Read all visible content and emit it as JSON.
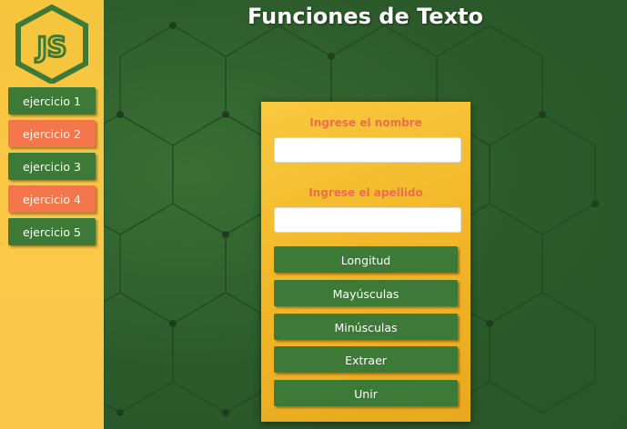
{
  "page": {
    "title": "Funciones de Texto"
  },
  "sidebar": {
    "logo_text": "JS",
    "items": [
      {
        "label": "ejercicio 1",
        "color": "#3e7a37"
      },
      {
        "label": "ejercicio 2",
        "color": "#f3774b"
      },
      {
        "label": "ejercicio 3",
        "color": "#3e7a37"
      },
      {
        "label": "ejercicio 4",
        "color": "#f3774b"
      },
      {
        "label": "ejercicio 5",
        "color": "#3e7a37"
      }
    ]
  },
  "form": {
    "nombre_label": "Ingrese el nombre",
    "nombre_value": "",
    "apellido_label": "Ingrese el apellido",
    "apellido_value": "",
    "buttons": {
      "longitud": "Longitud",
      "mayusculas": "Mayúsculas",
      "minusculas": "Minúsculas",
      "extraer": "Extraer",
      "unir": "Unir"
    }
  },
  "colors": {
    "accent_green": "#3e7a37",
    "accent_orange": "#f3774b",
    "label_color": "#f06c4e",
    "sidebar_yellow": "#f6c53e"
  }
}
